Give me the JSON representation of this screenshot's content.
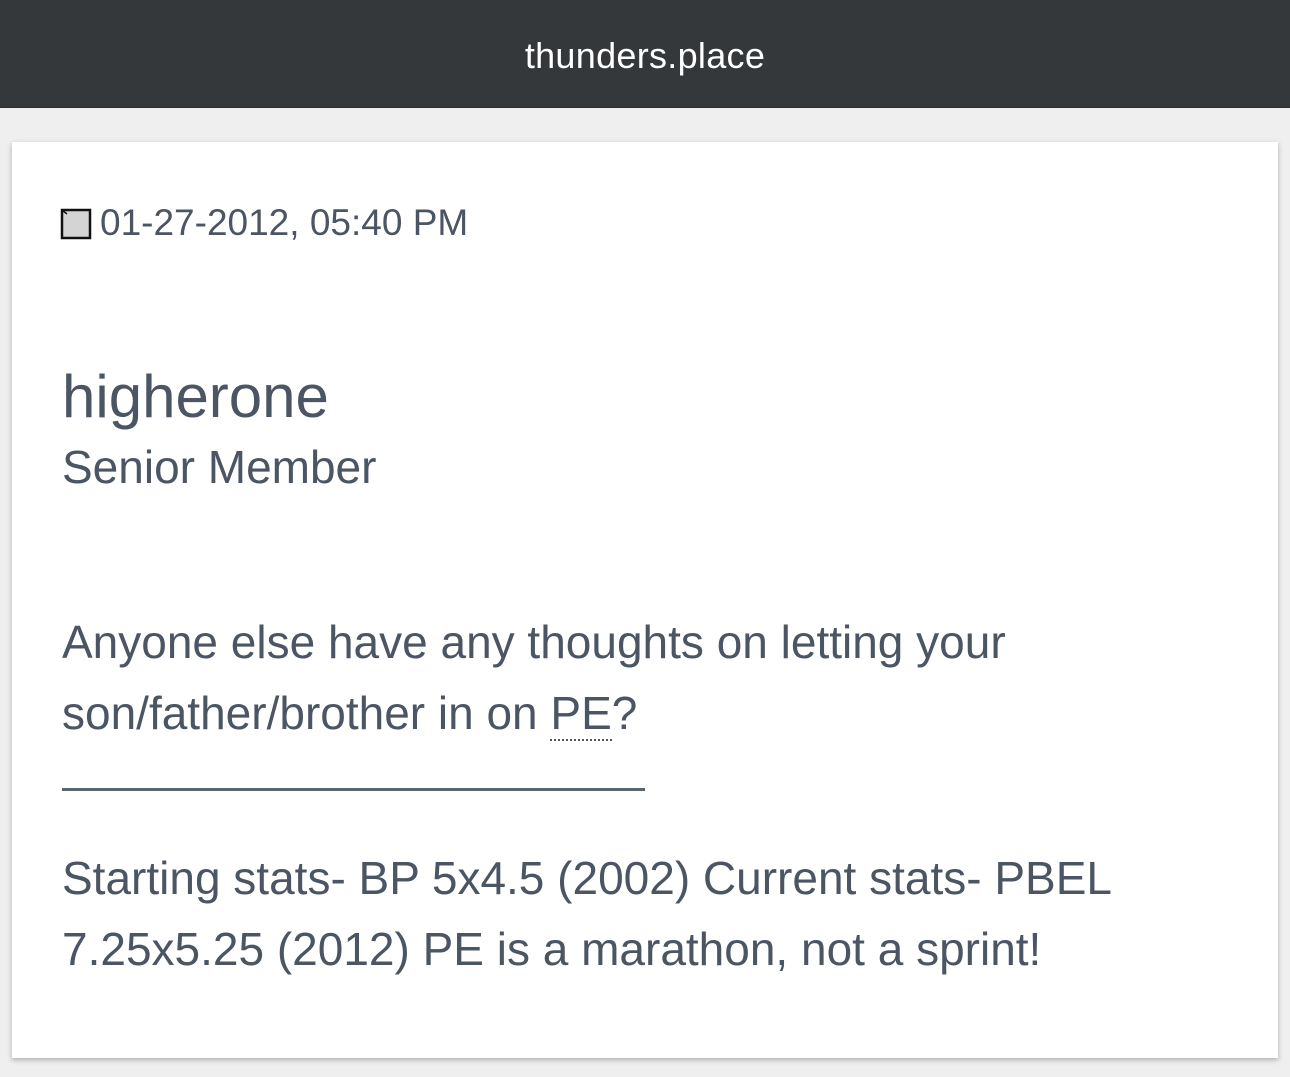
{
  "header": {
    "site_title": "thunders.place"
  },
  "post": {
    "icon": "post-document-icon",
    "datetime": "01-27-2012, 05:40 PM",
    "username": "higherone",
    "user_title": "Senior Member",
    "message_before": "Anyone else have any thoughts on letting your son/father/brother in on ",
    "message_acronym": "PE",
    "message_after": "?",
    "signature": "Starting stats- BP 5x4.5 (2002) Current stats- PBEL 7.25x5.25 (2012) PE is a marathon, not a sprint!"
  }
}
